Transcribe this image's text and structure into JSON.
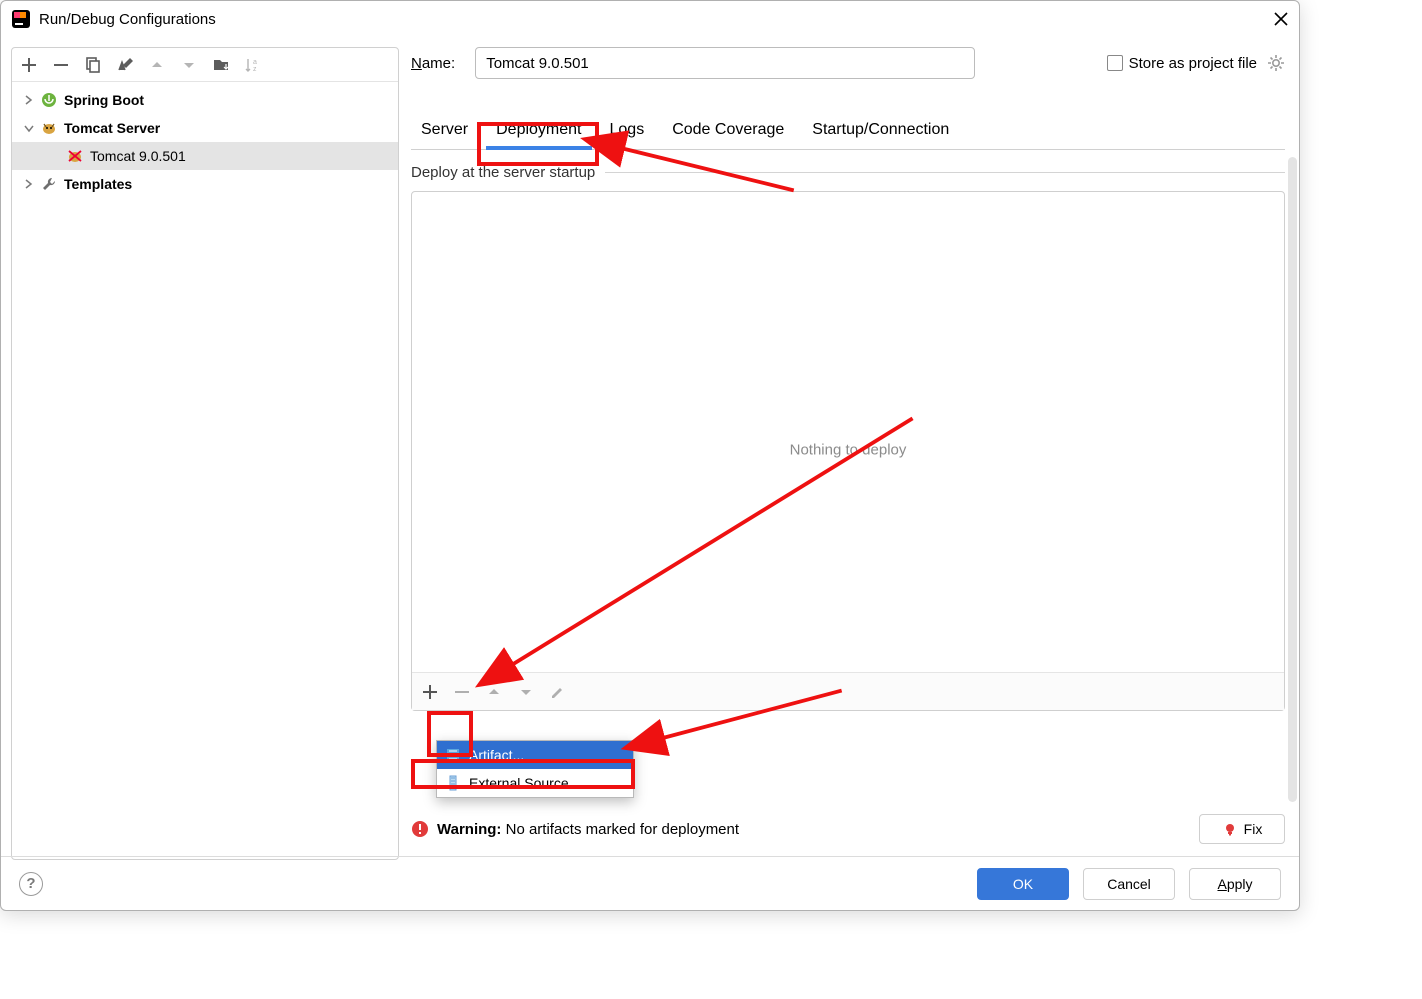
{
  "window": {
    "title": "Run/Debug Configurations"
  },
  "leftToolbar": {
    "add": "add",
    "remove": "remove",
    "copy": "copy",
    "editDefaults": "wrench",
    "moveUp": "up",
    "moveDown": "down",
    "saveAsFile": "folder",
    "sort": "sort"
  },
  "tree": {
    "items": [
      {
        "kind": "node",
        "label": "Spring Boot",
        "bold": true,
        "expanded": false,
        "icon": "spring"
      },
      {
        "kind": "node",
        "label": "Tomcat Server",
        "bold": true,
        "expanded": true,
        "icon": "tomcat"
      },
      {
        "kind": "leaf",
        "label": "Tomcat 9.0.501",
        "selected": true,
        "icon": "tomcat-bad",
        "indent": 2
      },
      {
        "kind": "node",
        "label": "Templates",
        "bold": true,
        "expanded": false,
        "icon": "wrench-gray"
      }
    ]
  },
  "form": {
    "nameLabel": "Name:",
    "nameValue": "Tomcat 9.0.501",
    "storeLabel": "Store as project file"
  },
  "tabs": [
    {
      "label": "Server",
      "selected": false
    },
    {
      "label": "Deployment",
      "selected": true
    },
    {
      "label": "Logs",
      "selected": false
    },
    {
      "label": "Code Coverage",
      "selected": false
    },
    {
      "label": "Startup/Connection",
      "selected": false
    }
  ],
  "deployment": {
    "sectionTitle": "Deploy at the server startup",
    "emptyText": "Nothing to deploy",
    "addMenu": [
      {
        "label": "Artifact...",
        "selected": true,
        "icon": "artifact"
      },
      {
        "label": "External Source...",
        "selected": false,
        "icon": "external"
      }
    ]
  },
  "warning": {
    "prefix": "Warning:",
    "text": " No artifacts marked for deployment",
    "fixLabel": "Fix"
  },
  "buttons": {
    "ok": "OK",
    "cancel": "Cancel",
    "apply": "Apply"
  }
}
